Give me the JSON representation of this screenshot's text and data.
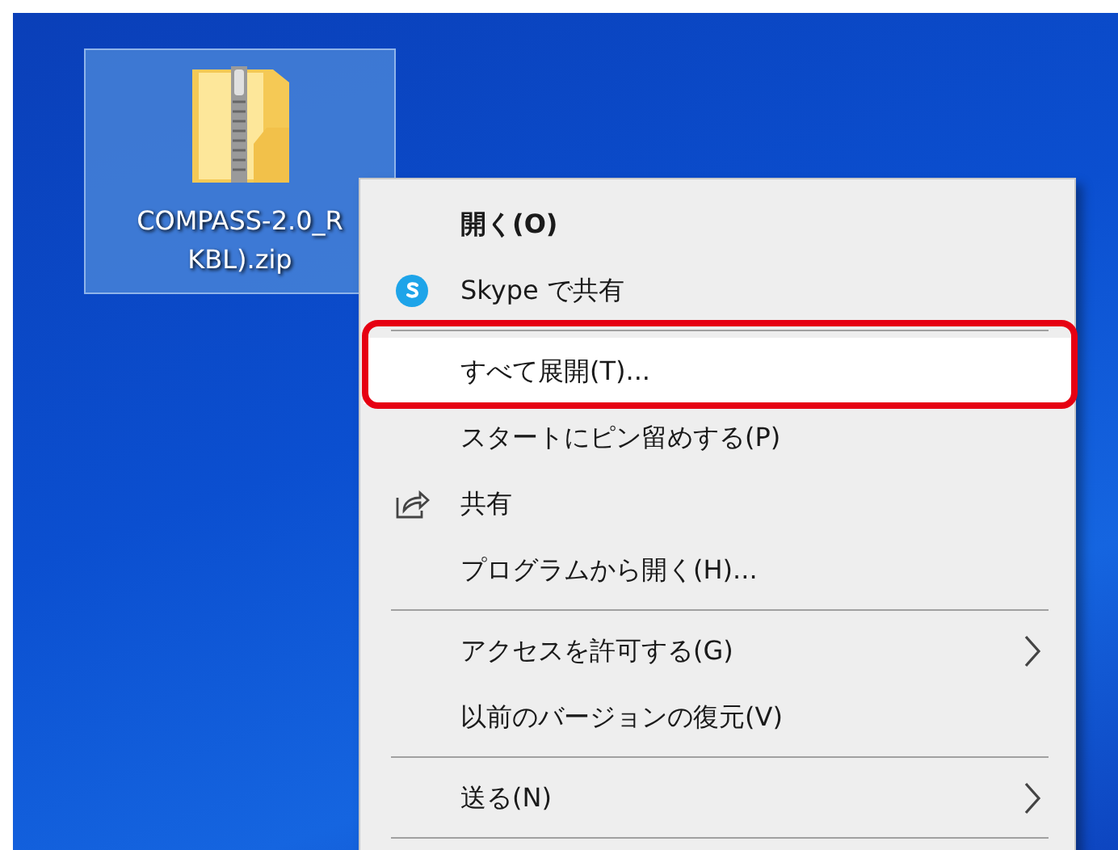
{
  "desktop_icon": {
    "label_lines": [
      "COMPASS-2.0_R",
      "KBL).zip"
    ],
    "selected": true
  },
  "context_menu": {
    "items": [
      {
        "kind": "item",
        "label": "開く(O)",
        "bold": true,
        "selected": false,
        "submenu": false,
        "callout": false
      },
      {
        "kind": "item",
        "label": "Skype で共有",
        "bold": false,
        "selected": false,
        "submenu": false,
        "callout": false
      },
      {
        "kind": "separator"
      },
      {
        "kind": "item",
        "label": "すべて展開(T)...",
        "bold": false,
        "selected": true,
        "submenu": false,
        "callout": true
      },
      {
        "kind": "item",
        "label": "スタートにピン留めする(P)",
        "bold": false,
        "selected": false,
        "submenu": false,
        "callout": false
      },
      {
        "kind": "item",
        "label": "共有",
        "bold": false,
        "selected": false,
        "submenu": false,
        "callout": false
      },
      {
        "kind": "item",
        "label": "プログラムから開く(H)...",
        "bold": false,
        "selected": false,
        "submenu": false,
        "callout": false
      },
      {
        "kind": "separator"
      },
      {
        "kind": "item",
        "label": "アクセスを許可する(G)",
        "bold": false,
        "selected": false,
        "submenu": true,
        "callout": false
      },
      {
        "kind": "item",
        "label": "以前のバージョンの復元(V)",
        "bold": false,
        "selected": false,
        "submenu": false,
        "callout": false
      },
      {
        "kind": "separator"
      },
      {
        "kind": "item",
        "label": "送る(N)",
        "bold": false,
        "selected": false,
        "submenu": true,
        "callout": false
      },
      {
        "kind": "separator"
      }
    ]
  }
}
